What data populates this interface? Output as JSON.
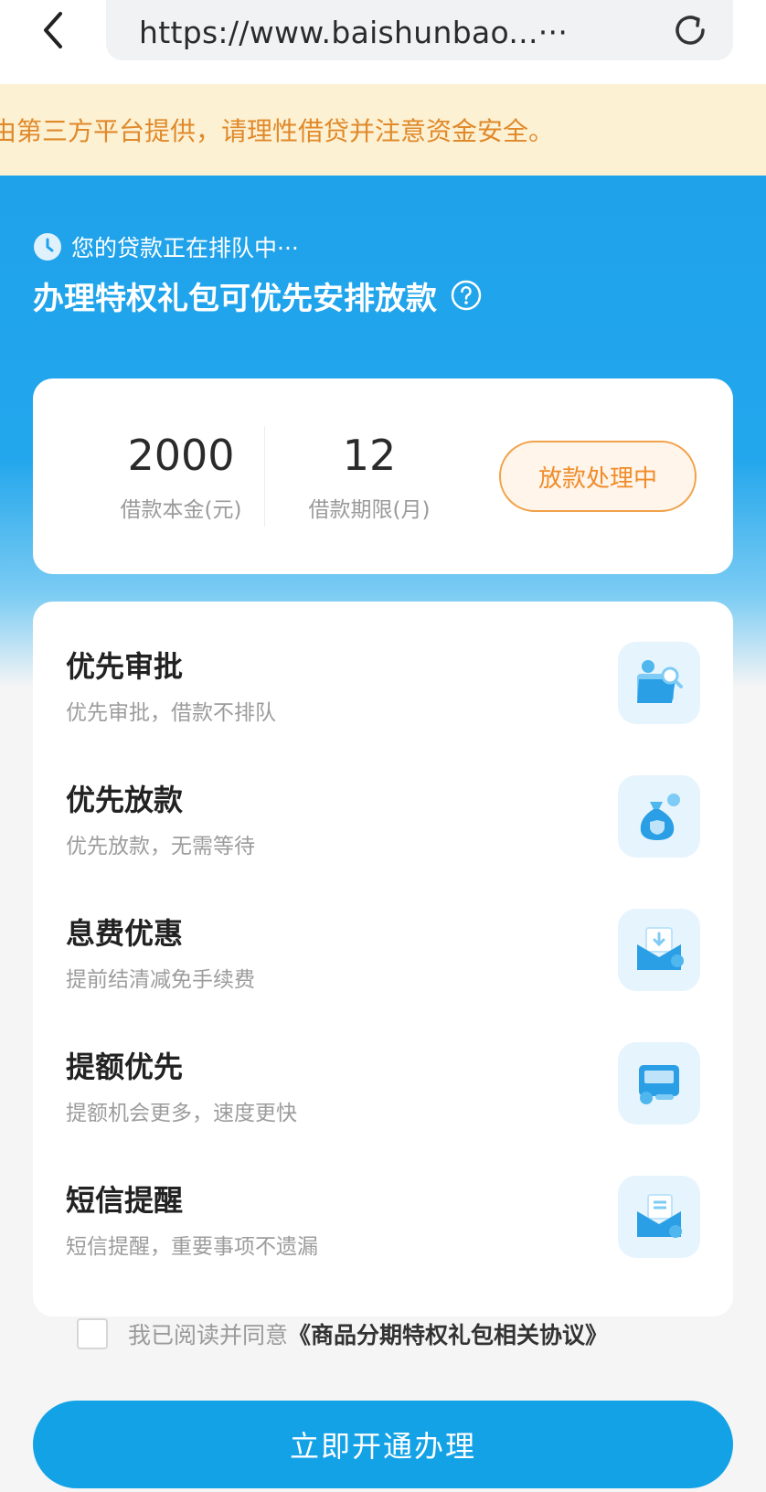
{
  "browser": {
    "url": "https://www.baishunbao...···"
  },
  "notice": {
    "text": "由第三方平台提供，请理性借贷并注意资金安全。"
  },
  "hero": {
    "queue_text": "您的贷款正在排队中···",
    "title": "办理特权礼包可优先安排放款"
  },
  "loan": {
    "principal_value": "2000",
    "principal_label": "借款本金(元)",
    "term_value": "12",
    "term_label": "借款期限(月)",
    "status_label": "放款处理中"
  },
  "features": [
    {
      "title": "优先审批",
      "desc": "优先审批，借款不排队",
      "icon": "folder-search-icon"
    },
    {
      "title": "优先放款",
      "desc": "优先放款，无需等待",
      "icon": "money-bag-icon"
    },
    {
      "title": "息费优惠",
      "desc": "提前结清减免手续费",
      "icon": "envelope-coin-icon"
    },
    {
      "title": "提额优先",
      "desc": "提额机会更多，速度更快",
      "icon": "card-coin-icon"
    },
    {
      "title": "短信提醒",
      "desc": "短信提醒，重要事项不遗漏",
      "icon": "message-coin-icon"
    }
  ],
  "agreement": {
    "prefix": "我已阅读并同意",
    "link": "《商品分期特权礼包相关协议》"
  },
  "cta": {
    "label": "立即开通办理"
  },
  "colors": {
    "primary_blue": "#14a2e6",
    "notice_bg": "#fdf1d3",
    "notice_text": "#e0892a",
    "status_orange": "#f08c2a"
  }
}
